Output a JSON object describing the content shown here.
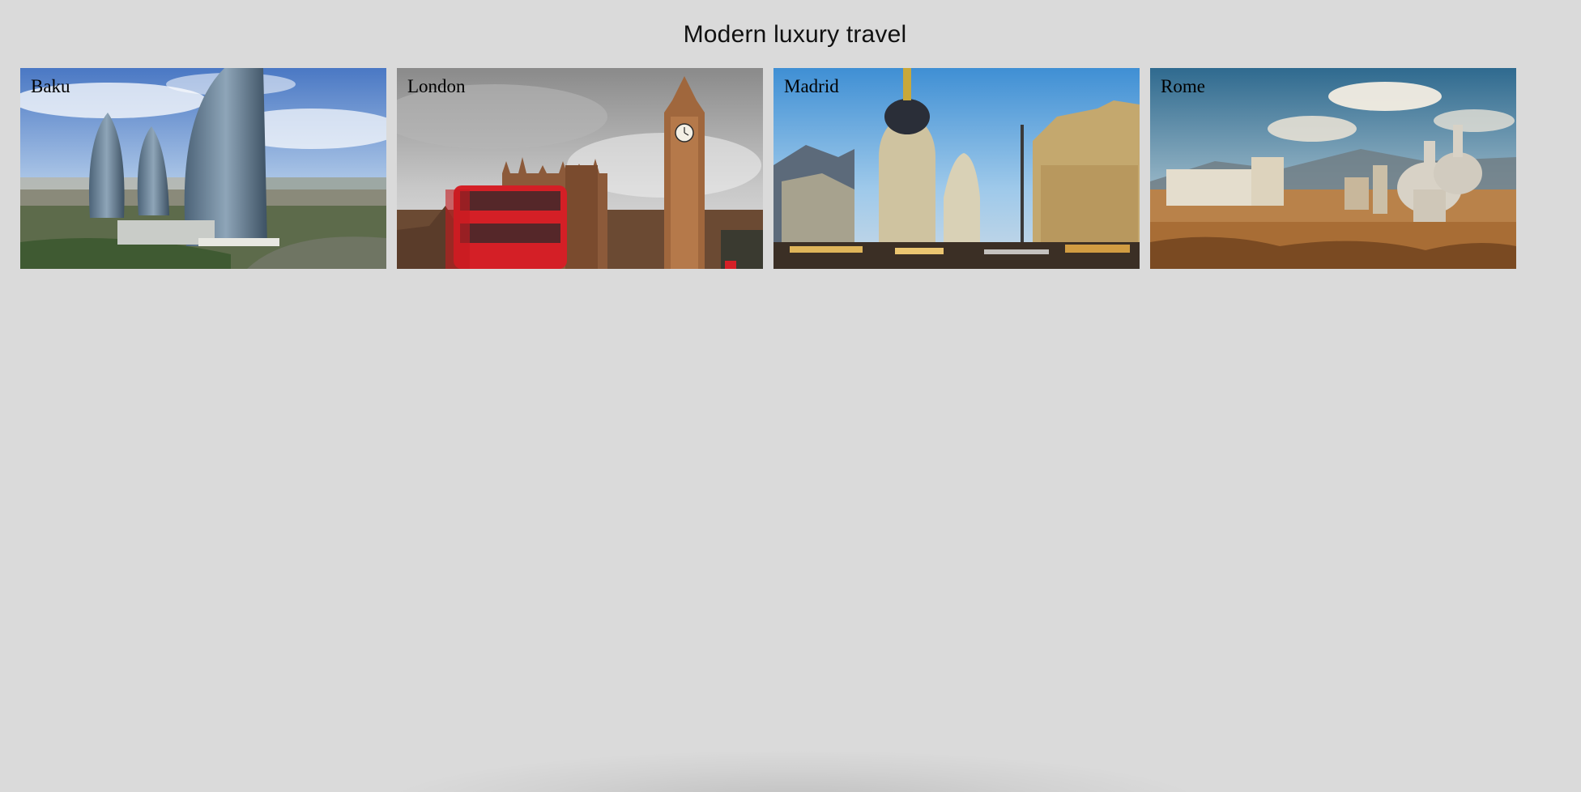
{
  "page": {
    "title": "Modern luxury travel",
    "background": "#dadada"
  },
  "destinations": [
    {
      "label": "Baku",
      "image": "baku-flame-towers-photo"
    },
    {
      "label": "London",
      "image": "london-big-ben-red-bus-photo"
    },
    {
      "label": "Madrid",
      "image": "madrid-metropolis-building-photo"
    },
    {
      "label": "Rome",
      "image": "rome-skyline-domes-photo"
    }
  ]
}
